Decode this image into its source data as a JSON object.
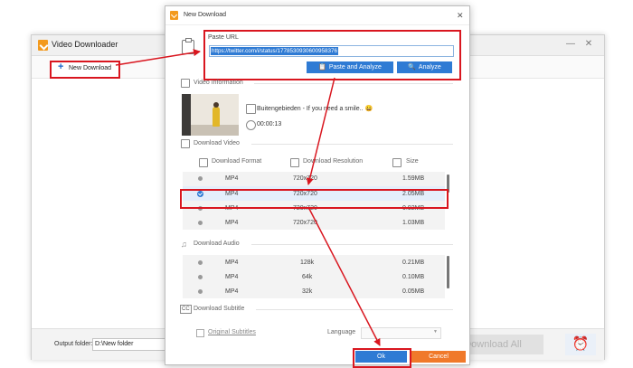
{
  "app": {
    "title": "Video Downloader",
    "new_download_label": "New Download",
    "output_folder_label": "Output folder:",
    "output_folder_value": "D:\\New folder",
    "download_all_label": "Download All",
    "icons": {
      "logo": "download-logo-icon",
      "add": "plus-icon",
      "alarm": "alarm-clock-icon"
    }
  },
  "dialog": {
    "title": "New Download",
    "paste_url_label": "Paste URL",
    "url_value": "https://twitter.com/i/status/1778530930600958376",
    "paste_analyze_label": "Paste and Analyze",
    "analyze_label": "Analyze",
    "video_info": {
      "section_label": "Video Information",
      "title": "Buitengebieden - If you need a smile.. 😀",
      "duration": "00:00:13"
    },
    "download_video": {
      "section_label": "Download Video",
      "headers": {
        "format": "Download Format",
        "resolution": "Download Resolution",
        "size": "Size"
      },
      "rows": [
        {
          "format": "MP4",
          "resolution": "720x720",
          "size": "1.59MB",
          "selected": false
        },
        {
          "format": "MP4",
          "resolution": "720x720",
          "size": "2.05MB",
          "selected": true
        },
        {
          "format": "MP4",
          "resolution": "720x720",
          "size": "0.92MB",
          "selected": false
        },
        {
          "format": "MP4",
          "resolution": "720x720",
          "size": "1.03MB",
          "selected": false
        }
      ]
    },
    "download_audio": {
      "section_label": "Download Audio",
      "rows": [
        {
          "format": "MP4",
          "bitrate": "128k",
          "size": "0.21MB"
        },
        {
          "format": "MP4",
          "bitrate": "64k",
          "size": "0.10MB"
        },
        {
          "format": "MP4",
          "bitrate": "32k",
          "size": "0.05MB"
        }
      ]
    },
    "download_subtitle": {
      "section_label": "Download Subtitle",
      "original_subtitles_label": "Original Subtitles",
      "language_label": "Language"
    },
    "ok_label": "Ok",
    "cancel_label": "Cancel"
  },
  "colors": {
    "accent_blue": "#2f7bd4",
    "annotation_red": "#d9161f",
    "cancel_orange": "#f0792a",
    "logo_orange": "#f39a1e"
  }
}
